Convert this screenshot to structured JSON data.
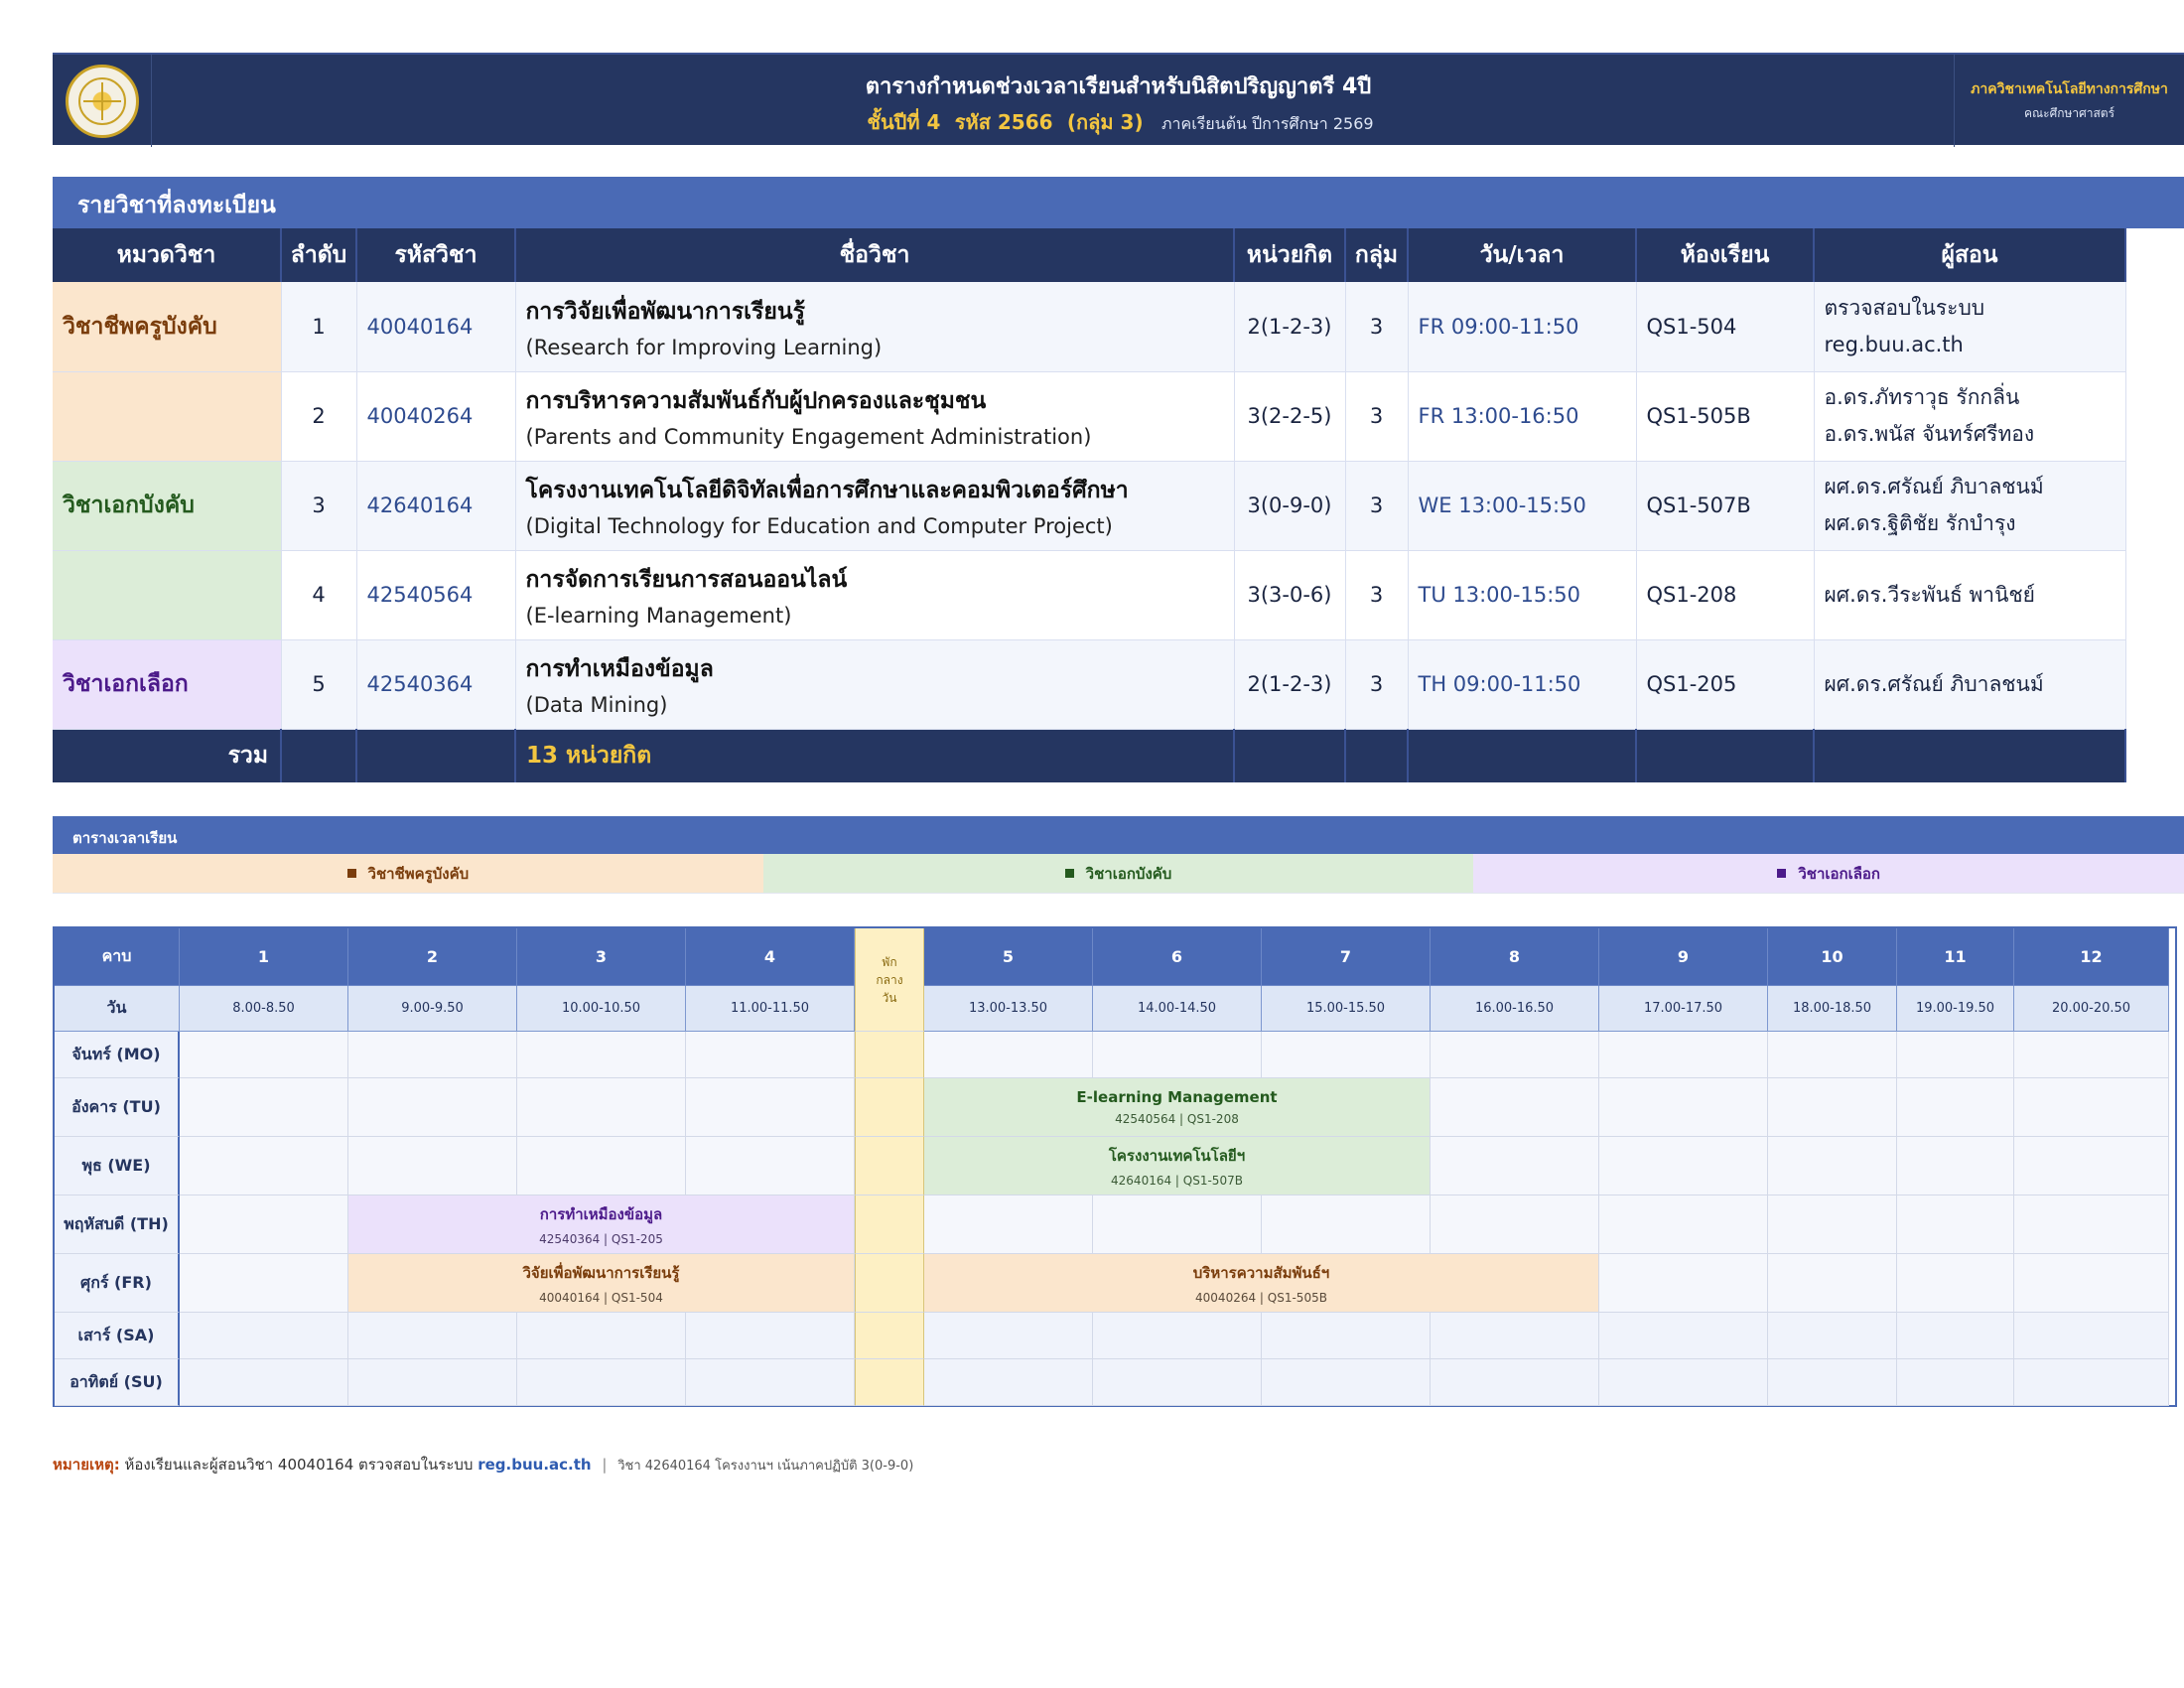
{
  "header": {
    "logo_text": "มหาวิทยาลัยบูรพา BURAPHA UNIVERSITY",
    "title": "ตารางกำหนดช่วงเวลาเรียนสำหรับนิสิตปริญญาตรี 4ปี",
    "year_level": "ชั้นปีที่ 4",
    "cohort": "รหัส 2566",
    "group": "(กลุ่ม 3)",
    "term": "ภาคเรียนต้น ปีการศึกษา 2569",
    "department": "ภาควิชาเทคโนโลยีทางการศึกษา",
    "faculty": "คณะศึกษาศาสตร์"
  },
  "courses_section": {
    "title": "รายวิชาที่ลงทะเบียน",
    "columns": [
      "หมวดวิชา",
      "ลำดับ",
      "รหัสวิชา",
      "ชื่อวิชา",
      "หน่วยกิต",
      "กลุ่ม",
      "วัน/เวลา",
      "ห้องเรียน",
      "ผู้สอน"
    ],
    "rows": [
      {
        "category": "วิชาชีพครูบังคับ",
        "no": "1",
        "code": "40040164",
        "name_th": "การวิจัยเพื่อพัฒนาการเรียนรู้",
        "name_en": "(Research for Improving Learning)",
        "credits": "2(1-2-3)",
        "group": "3",
        "time": "FR 09:00-11:50",
        "room": "QS1-504",
        "instructors": [
          "ตรวจสอบในระบบ reg.buu.ac.th"
        ]
      },
      {
        "category": "",
        "no": "2",
        "code": "40040264",
        "name_th": "การบริหารความสัมพันธ์กับผู้ปกครองและชุมชน",
        "name_en": "(Parents and Community Engagement Administration)",
        "credits": "3(2-2-5)",
        "group": "3",
        "time": "FR 13:00-16:50",
        "room": "QS1-505B",
        "instructors": [
          "อ.ดร.ภัทราวุธ รักกลิ่น",
          "อ.ดร.พนัส จันทร์ศรีทอง"
        ]
      },
      {
        "category": "วิชาเอกบังคับ",
        "no": "3",
        "code": "42640164",
        "name_th": "โครงงานเทคโนโลยีดิจิทัลเพื่อการศึกษาและคอมพิวเตอร์ศึกษา",
        "name_en": "(Digital Technology for Education and Computer Project)",
        "credits": "3(0-9-0)",
        "group": "3",
        "time": "WE 13:00-15:50",
        "room": "QS1-507B",
        "instructors": [
          "ผศ.ดร.ศรัณย์ ภิบาลชนม์",
          "ผศ.ดร.ฐิติชัย รักบำรุง"
        ]
      },
      {
        "category": "",
        "no": "4",
        "code": "42540564",
        "name_th": "การจัดการเรียนการสอนออนไลน์",
        "name_en": "(E-learning Management)",
        "credits": "3(3-0-6)",
        "group": "3",
        "time": "TU 13:00-15:50",
        "room": "QS1-208",
        "instructors": [
          "ผศ.ดร.วีระพันธ์ พานิชย์"
        ]
      },
      {
        "category": "วิชาเอกเลือก",
        "no": "5",
        "code": "42540364",
        "name_th": "การทำเหมืองข้อมูล",
        "name_en": "(Data Mining)",
        "credits": "2(1-2-3)",
        "group": "3",
        "time": "TH 09:00-11:50",
        "room": "QS1-205",
        "instructors": [
          "ผศ.ดร.ศรัณย์ ภิบาลชนม์"
        ]
      }
    ],
    "total_label": "รวม",
    "total_value": "13  หน่วยกิต"
  },
  "timetable": {
    "title": "ตารางเวลาเรียน",
    "legend": [
      "วิชาชีพครูบังคับ",
      "วิชาเอกบังคับ",
      "วิชาเอกเลือก"
    ],
    "period_label": "คาบ",
    "day_label": "วัน",
    "periods": [
      "1",
      "2",
      "3",
      "4",
      "5",
      "6",
      "7",
      "8",
      "9",
      "10",
      "11",
      "12"
    ],
    "break_label": "พัก กลาง วัน",
    "times": [
      "8.00-8.50",
      "9.00-9.50",
      "10.00-10.50",
      "11.00-11.50",
      "13.00-13.50",
      "14.00-14.50",
      "15.00-15.50",
      "16.00-16.50",
      "17.00-17.50",
      "18.00-18.50",
      "19.00-19.50",
      "20.00-20.50"
    ],
    "days": [
      "จันทร์ (MO)",
      "อังคาร (TU)",
      "พุธ (WE)",
      "พฤหัสบดี (TH)",
      "ศุกร์ (FR)",
      "เสาร์ (SA)",
      "อาทิตย์ (SU)"
    ],
    "classes": {
      "tu": {
        "name": "E-learning Management",
        "meta": "42540564 | QS1-208"
      },
      "we": {
        "name": "โครงงานเทคโนโลยีฯ",
        "meta": "42640164 | QS1-507B"
      },
      "th": {
        "name": "การทำเหมืองข้อมูล",
        "meta": "42540364 | QS1-205"
      },
      "fr_am": {
        "name": "วิจัยเพื่อพัฒนาการเรียนรู้",
        "meta": "40040164 | QS1-504"
      },
      "fr_pm": {
        "name": "บริหารความสัมพันธ์ฯ",
        "meta": "40040264 | QS1-505B"
      }
    }
  },
  "footnote": {
    "label": "หมายเหตุ:",
    "text": "ห้องเรียนและผู้สอนวิชา 40040164 ตรวจสอบในระบบ",
    "link": "reg.buu.ac.th",
    "sep": "|",
    "extra": "วิชา 42640164 โครงงานฯ เน้นภาคปฏิบัติ 3(0-9-0)"
  }
}
